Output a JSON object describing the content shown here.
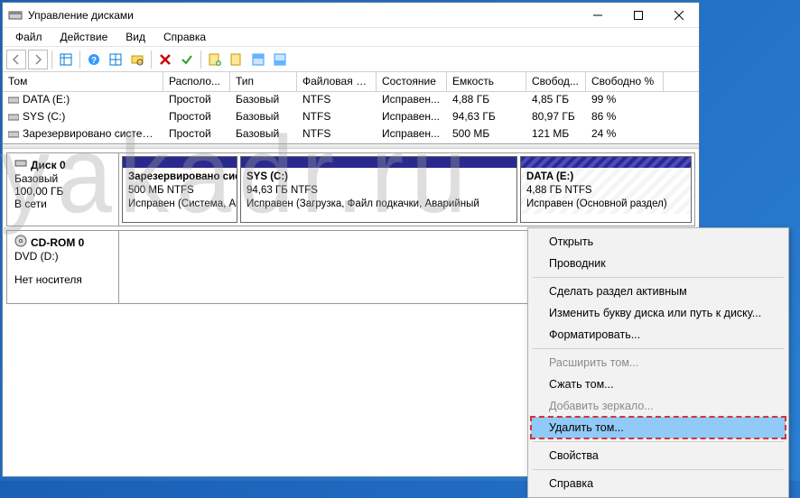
{
  "watermark": "yakadr.ru",
  "window": {
    "title": "Управление дисками"
  },
  "menu": {
    "items": [
      "Файл",
      "Действие",
      "Вид",
      "Справка"
    ]
  },
  "columns": {
    "c0": "Том",
    "c1": "Располо...",
    "c2": "Тип",
    "c3": "Файловая с...",
    "c4": "Состояние",
    "c5": "Емкость",
    "c6": "Свобод...",
    "c7": "Свободно %"
  },
  "volumes": [
    {
      "name": "DATA (E:)",
      "layout": "Простой",
      "type": "Базовый",
      "fs": "NTFS",
      "status": "Исправен...",
      "cap": "4,88 ГБ",
      "free": "4,85 ГБ",
      "pct": "99 %"
    },
    {
      "name": "SYS (C:)",
      "layout": "Простой",
      "type": "Базовый",
      "fs": "NTFS",
      "status": "Исправен...",
      "cap": "94,63 ГБ",
      "free": "80,97 ГБ",
      "pct": "86 %"
    },
    {
      "name": "Зарезервировано системой",
      "layout": "Простой",
      "type": "Базовый",
      "fs": "NTFS",
      "status": "Исправен...",
      "cap": "500 МБ",
      "free": "121 МБ",
      "pct": "24 %"
    }
  ],
  "disk0": {
    "name": "Диск 0",
    "type": "Базовый",
    "size": "100,00 ГБ",
    "status": "В сети",
    "parts": [
      {
        "name": "Зарезервировано систе",
        "size": "500 МБ NTFS",
        "state": "Исправен (Система, Акти"
      },
      {
        "name": "SYS  (C:)",
        "size": "94,63 ГБ NTFS",
        "state": "Исправен (Загрузка, Файл подкачки, Аварийный"
      },
      {
        "name": "DATA  (E:)",
        "size": "4,88 ГБ NTFS",
        "state": "Исправен (Основной раздел)"
      }
    ]
  },
  "cdrom": {
    "name": "CD-ROM 0",
    "type": "DVD (D:)",
    "status": "Нет носителя"
  },
  "context": {
    "open": "Открыть",
    "explorer": "Проводник",
    "make_active": "Сделать раздел активным",
    "change_letter": "Изменить букву диска или путь к диску...",
    "format": "Форматировать...",
    "extend": "Расширить том...",
    "shrink": "Сжать том...",
    "add_mirror": "Добавить зеркало...",
    "delete": "Удалить том...",
    "properties": "Свойства",
    "help": "Справка"
  }
}
